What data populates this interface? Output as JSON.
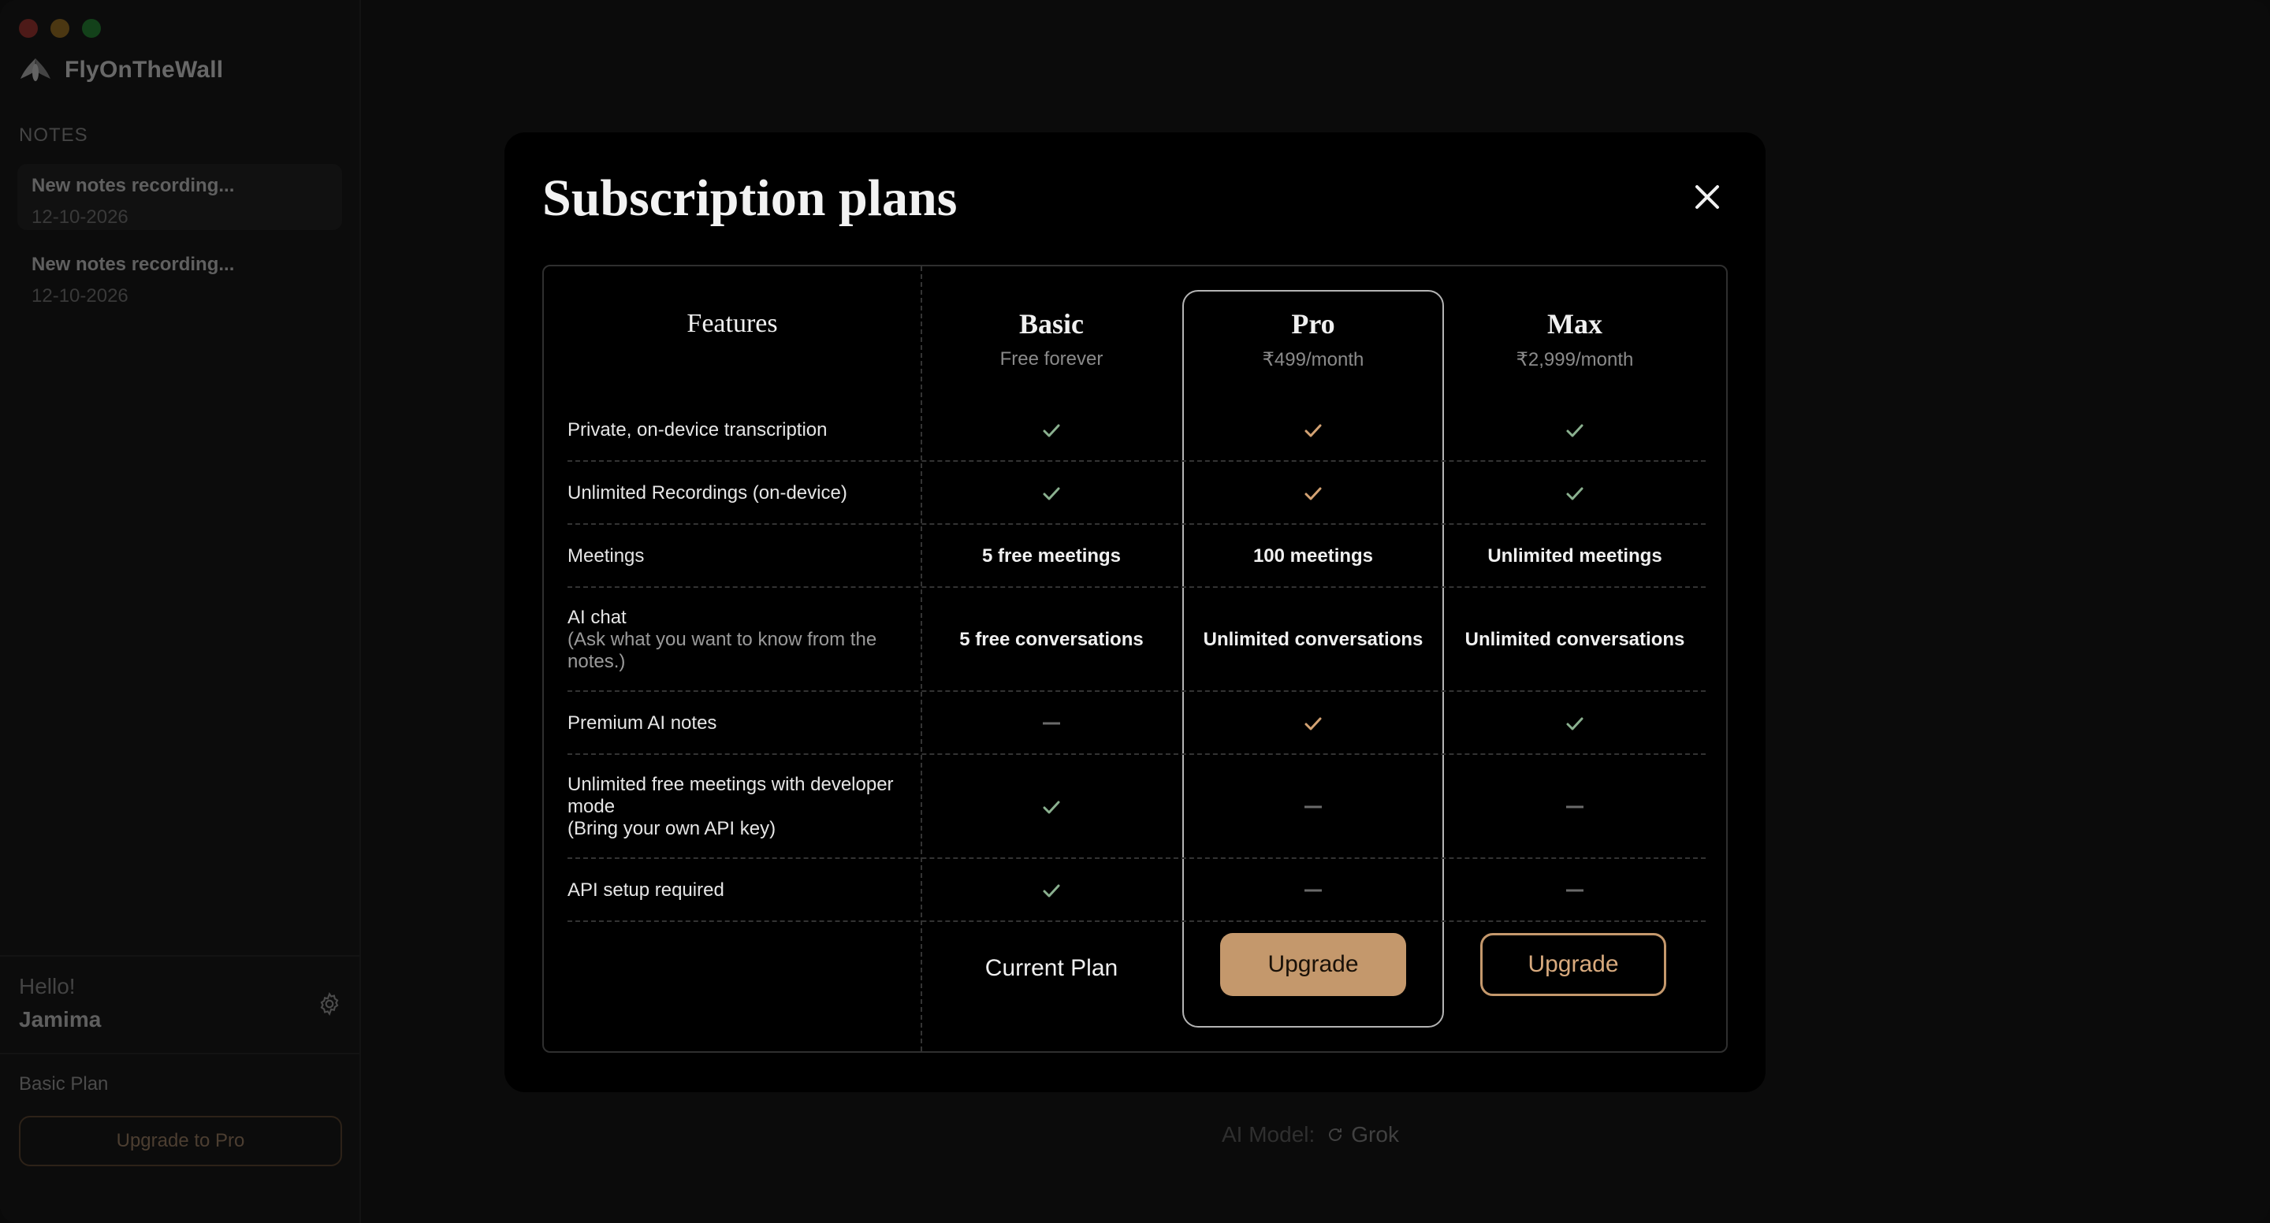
{
  "app": {
    "name": "FlyOnTheWall"
  },
  "sidebar": {
    "section_label": "NOTES",
    "notes": [
      {
        "title": "New notes recording...",
        "date": "12-10-2026"
      },
      {
        "title": "New notes recording...",
        "date": "12-10-2026"
      }
    ],
    "greeting": "Hello!",
    "user_name": "Jamima",
    "plan_label": "Basic Plan",
    "upgrade_button": "Upgrade to Pro"
  },
  "main": {
    "ai_model_label": "AI Model:",
    "ai_model_value": "Grok"
  },
  "modal": {
    "title": "Subscription plans",
    "features_header": "Features",
    "plans": [
      {
        "name": "Basic",
        "price": "Free forever"
      },
      {
        "name": "Pro",
        "price": "₹499/month"
      },
      {
        "name": "Max",
        "price": "₹2,999/month"
      }
    ],
    "rows": [
      {
        "feature": "Private, on-device transcription",
        "sub": "",
        "values": [
          "check",
          "check",
          "check"
        ]
      },
      {
        "feature": "Unlimited Recordings (on-device)",
        "sub": "",
        "values": [
          "check",
          "check",
          "check"
        ]
      },
      {
        "feature": "Meetings",
        "sub": "",
        "values": [
          "5 free meetings",
          "100 meetings",
          "Unlimited meetings"
        ]
      },
      {
        "feature": "AI chat",
        "sub": "(Ask what you want to know from the notes.)",
        "values": [
          "5 free conversations",
          "Unlimited conversations",
          "Unlimited conversations"
        ]
      },
      {
        "feature": "Premium AI notes",
        "sub": "",
        "values": [
          "dash",
          "check",
          "check"
        ]
      },
      {
        "feature": "Unlimited free meetings with developer mode",
        "sub": "(Bring your own API key)",
        "values": [
          "check",
          "dash",
          "dash"
        ]
      },
      {
        "feature": "API setup required",
        "sub": "",
        "values": [
          "check",
          "dash",
          "dash"
        ]
      }
    ],
    "current_plan": "Current Plan",
    "upgrade_pro": "Upgrade",
    "upgrade_max": "Upgrade"
  },
  "colors": {
    "accent": "#c4986c",
    "check_green": "#8ab08f",
    "check_orange": "#d3a273",
    "dash": "#6a6a6a"
  }
}
